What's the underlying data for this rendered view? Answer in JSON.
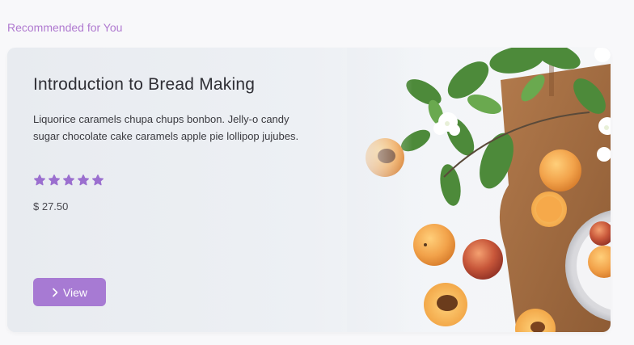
{
  "section": {
    "title": "Recommended for You"
  },
  "card": {
    "title": "Introduction to Bread Making",
    "description": "Liquorice caramels chupa chups bonbon. Jelly-o candy sugar chocolate cake caramels apple pie lollipop jujubes.",
    "rating": 5,
    "rating_max": 5,
    "price": "$ 27.50",
    "button_label": "View",
    "button_icon": "chevron-right-icon",
    "image_description_icon": "food-photo"
  },
  "colors": {
    "accent": "#a77ad3",
    "section_title": "#b07ad0",
    "star": "#9b6fcf",
    "text_dark": "#2f2f35",
    "card_bg": "#e9ecf1"
  }
}
